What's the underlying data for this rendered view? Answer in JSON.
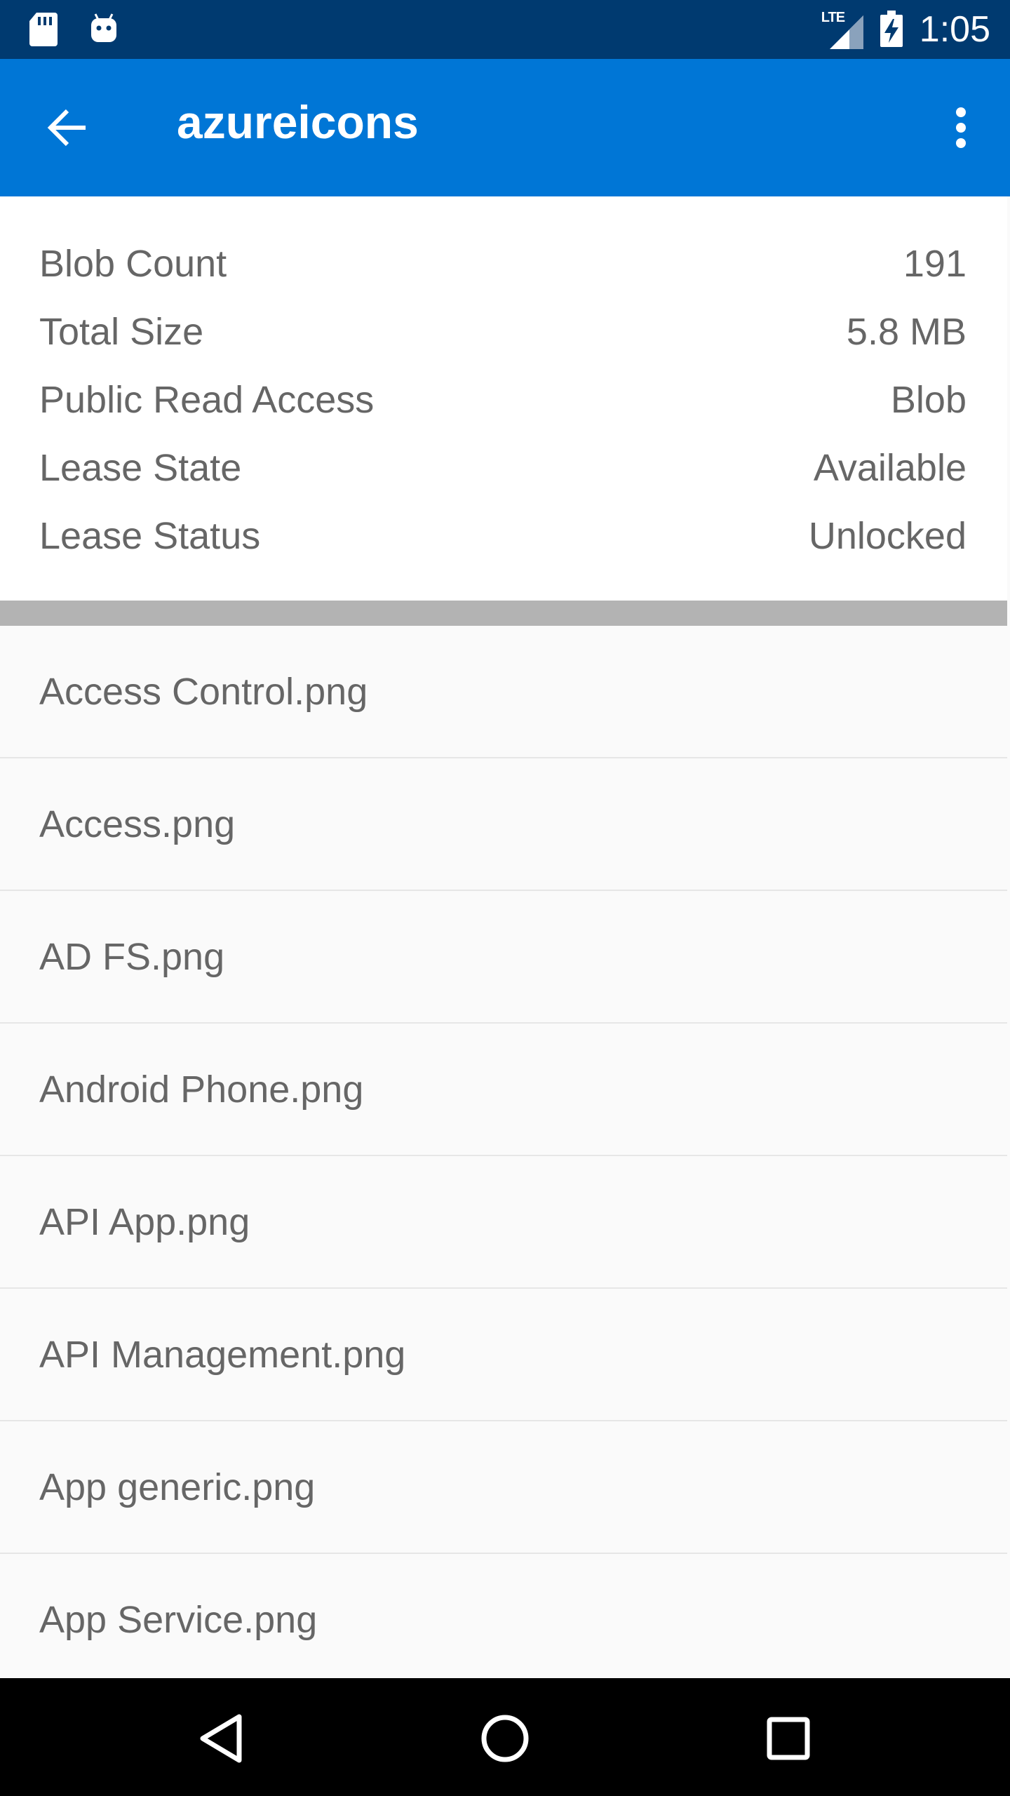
{
  "status_bar": {
    "network_label": "LTE",
    "time": "1:05"
  },
  "app_bar": {
    "title": "azureicons"
  },
  "properties": [
    {
      "label": "Blob Count",
      "value": "191"
    },
    {
      "label": "Total Size",
      "value": "5.8 MB"
    },
    {
      "label": "Public Read Access",
      "value": "Blob"
    },
    {
      "label": "Lease State",
      "value": "Available"
    },
    {
      "label": "Lease Status",
      "value": "Unlocked"
    }
  ],
  "files": [
    "Access Control.png",
    "Access.png",
    "AD FS.png",
    "Android Phone.png",
    "API App.png",
    "API Management.png",
    "App generic.png",
    "App Service.png"
  ],
  "colors": {
    "status_bar": "#003a70",
    "app_bar": "#0076d6",
    "text_gray": "#666666"
  },
  "icons": {
    "status_left": [
      "sd-card-icon",
      "android-debug-icon"
    ],
    "status_right": [
      "signal-icon",
      "battery-charging-icon"
    ],
    "app_bar": [
      "back-arrow-icon",
      "more-vert-icon"
    ],
    "nav": [
      "back-triangle-icon",
      "home-circle-icon",
      "recents-square-icon"
    ]
  }
}
